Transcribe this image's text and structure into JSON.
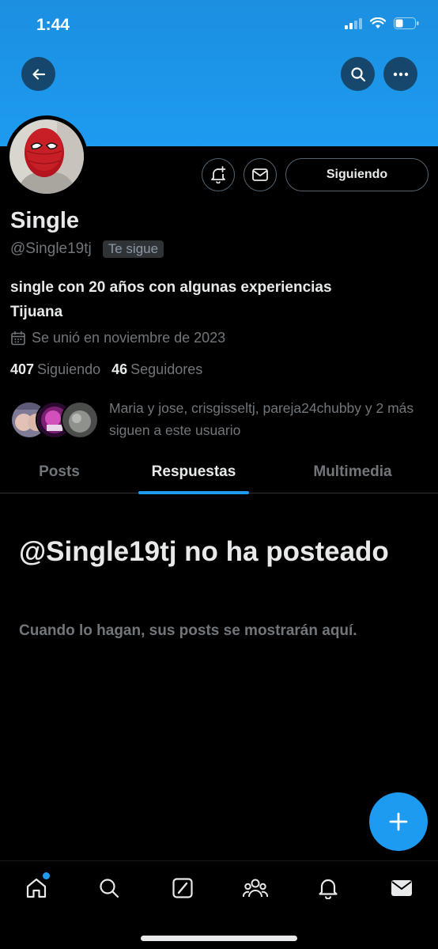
{
  "status_bar": {
    "time": "1:44",
    "icons": [
      "signal-icon",
      "wifi-icon",
      "battery-icon"
    ]
  },
  "header": {
    "buttons": [
      "back-arrow-icon",
      "search-icon",
      "more-icon"
    ],
    "banner_color": "#1d9bf0"
  },
  "profile": {
    "display_name": "Single",
    "handle": "@Single19tj",
    "follows_you": "Te sigue",
    "bio_line1": "single con 20 años con algunas experiencias",
    "bio_line2": "Tijuana",
    "joined": "Se unió en noviembre de 2023",
    "following_count": "407",
    "following_label": "Siguiendo",
    "followers_count": "46",
    "followers_label": "Seguidores",
    "followers_you_know": "Maria y jose, crisgisseltj, pareja24chubby y 2 más siguen a este usuario"
  },
  "actions": {
    "following_button": "Siguiendo",
    "icons": [
      "bell-plus-icon",
      "mail-icon"
    ]
  },
  "tabs": [
    {
      "label": "Posts",
      "active": false
    },
    {
      "label": "Respuestas",
      "active": true
    },
    {
      "label": "Multimedia",
      "active": false
    }
  ],
  "empty_state": {
    "title": "@Single19tj no ha posteado",
    "subtitle": "Cuando lo hagan, sus posts se mostrarán aquí."
  },
  "fab": {
    "icon": "plus-icon"
  },
  "bottom_nav": [
    {
      "icon": "home-icon",
      "badge": true
    },
    {
      "icon": "search-icon",
      "badge": false
    },
    {
      "icon": "grok-icon",
      "badge": false
    },
    {
      "icon": "communities-icon",
      "badge": false
    },
    {
      "icon": "bell-icon",
      "badge": false
    },
    {
      "icon": "mail-icon",
      "badge": false
    }
  ],
  "colors": {
    "accent": "#1d9bf0",
    "text_primary": "#e7e9ea",
    "text_secondary": "#71767b",
    "background": "#000000"
  }
}
